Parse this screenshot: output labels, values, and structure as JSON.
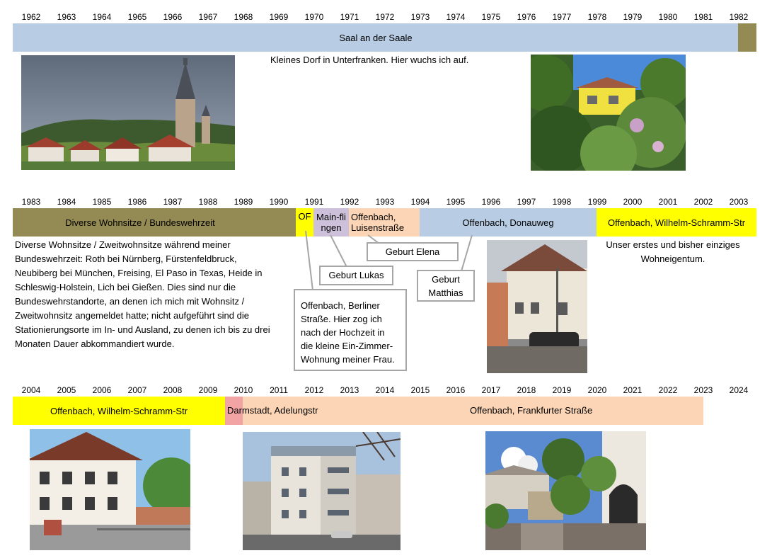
{
  "row1": {
    "years": [
      "1962",
      "1963",
      "1964",
      "1965",
      "1966",
      "1967",
      "1968",
      "1969",
      "1970",
      "1971",
      "1972",
      "1973",
      "1974",
      "1975",
      "1976",
      "1977",
      "1978",
      "1979",
      "1980",
      "1981",
      "1982"
    ],
    "bar_main": "Saal an der Saale",
    "description": "Kleines Dorf in Unterfranken. Hier wuchs ich auf."
  },
  "row2": {
    "years": [
      "1983",
      "1984",
      "1985",
      "1986",
      "1987",
      "1988",
      "1989",
      "1990",
      "1991",
      "1992",
      "1993",
      "1994",
      "1995",
      "1996",
      "1997",
      "1998",
      "1999",
      "2000",
      "2001",
      "2002",
      "2003"
    ],
    "bar_bundeswehr": "Diverse Wohnsitze /  Bundeswehrzeit",
    "bar_of": "OF",
    "bar_mainflingen": "Main-flingen",
    "bar_luisen": "Offenbach, Luisenstraße",
    "bar_donauweg": "Offenbach, Donauweg",
    "bar_wilhelm": "Offenbach, Wilhelm-Schramm-Str",
    "bundeswehr_text": [
      "Diverse Wohnsitze / Zweitwohnsitze während meiner",
      "Bundeswehrzeit: Roth bei Nürnberg, Fürstenfeldbruck,",
      "Neubiberg bei München, Freising, El Paso in Texas, Heide in",
      "Schleswig-Holstein, Lich bei Gießen. Dies sind nur die",
      "Bundeswehrstandorte, an denen ich mich mit Wohnsitz /",
      "Zweitwohnsitz angemeldet hatte; nicht aufgeführt sind die",
      "Stationierungsorte im In- und Ausland, zu denen ich bis zu drei",
      "Monaten Dauer abkommandiert wurde."
    ],
    "wilhelm_text": [
      "Unser erstes und bisher einziges",
      "Wohneigentum."
    ],
    "callout_berliner": [
      "Offenbach, Berliner",
      "Straße.  Hier zog ich",
      "nach der Hochzeit in",
      "die kleine Ein-Zimmer-",
      "Wohnung meiner Frau."
    ],
    "callout_lukas": "Geburt Lukas",
    "callout_elena": "Geburt Elena",
    "callout_matthias": [
      "Geburt",
      "Matthias"
    ]
  },
  "row3": {
    "years": [
      "2004",
      "2005",
      "2006",
      "2007",
      "2008",
      "2009",
      "2010",
      "2011",
      "2012",
      "2013",
      "2014",
      "2015",
      "2016",
      "2017",
      "2018",
      "2019",
      "2020",
      "2021",
      "2022",
      "2023",
      "2024"
    ],
    "bar_wilhelm": "Offenbach, Wilhelm-Schramm-Str",
    "bar_darmstadt": "Darmstadt, Adelungstr",
    "bar_frankfurter": "Offenbach, Frankfurter Straße"
  },
  "colors": {
    "saal": "#b8cce4",
    "olive": "#948a54",
    "yellow": "#ffff00",
    "lavender": "#ccc0da",
    "peach": "#fbd5b5",
    "blue": "#b8cce4",
    "pink": "#f2a4a4",
    "callout_border": "#a6a6a6"
  },
  "photos": {
    "church": "church-village-photo",
    "yellow_house": "yellow-house-garden-photo",
    "donauweg_house": "donauweg-house-photo",
    "wilhelm_house": "wilhelm-schramm-house-photo",
    "darmstadt_building": "darmstadt-building-photo",
    "frankfurter_courtyard": "frankfurter-courtyard-photo"
  }
}
